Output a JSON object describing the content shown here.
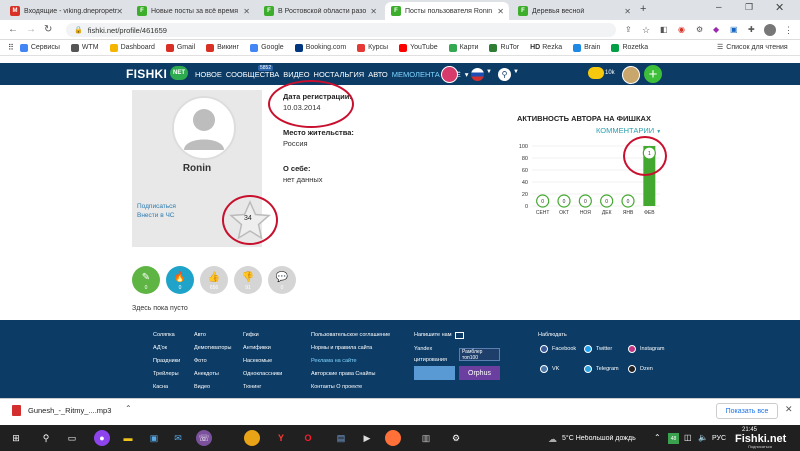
{
  "browser": {
    "tabs": [
      {
        "title": "Входящие - viking.dnepropetr",
        "icon_color": "#d93025",
        "icon_letter": "M"
      },
      {
        "title": "Новые посты за всё время",
        "icon_color": "#3dae2b",
        "icon_letter": "F"
      },
      {
        "title": "В Ростовской области разо",
        "icon_color": "#3dae2b",
        "icon_letter": "F"
      },
      {
        "title": "Посты пользователя Ronin",
        "icon_color": "#3dae2b",
        "icon_letter": "F",
        "active": true
      },
      {
        "title": "Деревья весной",
        "icon_color": "#3dae2b",
        "icon_letter": "F"
      }
    ],
    "new_tab": "+",
    "url": "fishki.net/profile/461659",
    "bookmarks": [
      {
        "label": "Сервисы",
        "color": "#4285f4"
      },
      {
        "label": "WTM",
        "color": "#555555"
      },
      {
        "label": "Dashboard",
        "color": "#f4b400"
      },
      {
        "label": "Gmail",
        "color": "#d93025"
      },
      {
        "label": "Викинг",
        "color": "#d93025"
      },
      {
        "label": "Google",
        "color": "#4285f4"
      },
      {
        "label": "Booking.com",
        "color": "#003580"
      },
      {
        "label": "Курсы",
        "color": "#e53935"
      },
      {
        "label": "YouTube",
        "color": "#ff0000"
      },
      {
        "label": "Карти",
        "color": "#34a853"
      },
      {
        "label": "RuTor",
        "color": "#2e7d32"
      },
      {
        "label": "Rezka",
        "color": "#222222"
      },
      {
        "label": "Brain",
        "color": "#1e88e5"
      },
      {
        "label": "Rozetka",
        "color": "#00a046"
      }
    ],
    "bookmarks_right": "Список для чтения",
    "hd_prefix": "HD"
  },
  "site": {
    "logo": "FISHKI",
    "logo_badge": "NET",
    "nav": [
      "НОВОЕ",
      "СООБЩЕСТВА",
      "ВИДЕО",
      "НОСТАЛЬГИЯ",
      "АВТО",
      "МЕМОЛЕНТА",
      "ЕЩЁ"
    ],
    "nav_badge": "5852",
    "balance": "10k"
  },
  "profile": {
    "username": "Ronin",
    "subscribe_link": "Подписаться",
    "blacklist_link": "Внести в ЧС",
    "rating": "34",
    "reg_label": "Дата регистрации:",
    "reg_value": "10.03.2014",
    "place_label": "Место жительства:",
    "place_value": "Россия",
    "about_label": "О себе:",
    "about_value": "нет данных",
    "actions": [
      {
        "icon": "pencil-icon",
        "glyph": "✎",
        "count": "0",
        "color": "#5fb544"
      },
      {
        "icon": "fire-icon",
        "glyph": "🔥",
        "count": "0",
        "color": "#1fa3c9"
      },
      {
        "icon": "thumbs-up-icon",
        "glyph": "👍",
        "count": "656",
        "color": "#d5d5d5"
      },
      {
        "icon": "thumbs-down-icon",
        "glyph": "👎",
        "count": "91",
        "color": "#d5d5d5"
      },
      {
        "icon": "comment-icon",
        "glyph": "💬",
        "count": "0",
        "color": "#d5d5d5"
      }
    ],
    "empty_text": "Здесь пока пусто"
  },
  "chart_data": {
    "type": "bar",
    "title": "АКТИВНОСТЬ АВТОРА НА ФИШКАХ",
    "subtitle": "КОММЕНТАРИИ",
    "categories": [
      "СЕНТ",
      "ОКТ",
      "НОЯ",
      "ДЕК",
      "ЯНВ",
      "ФЕВ"
    ],
    "values": [
      0,
      0,
      0,
      0,
      0,
      100
    ],
    "point_labels": [
      "0",
      "0",
      "0",
      "0",
      "0",
      "1"
    ],
    "ylim": [
      0,
      100
    ],
    "yticks": [
      0,
      20,
      40,
      60,
      80,
      100
    ],
    "grid": true,
    "bar_color": "#43a82f"
  },
  "footer": {
    "col1": [
      "Соляпка",
      "АД'ок",
      "Праздники",
      "Трейлеры",
      "Касна"
    ],
    "col2": [
      "Авто",
      "Демотиваторы",
      "Фото",
      "Анекдоты",
      "Видео"
    ],
    "col3": [
      "Гифки",
      "Антификки",
      "Насекомые",
      "Одноклассники",
      "Тюнинг"
    ],
    "col4": [
      "Пользовательское соглашение",
      "Нормы и правила сайта",
      "Реклама на сайте",
      "Авторские права  Снайпы",
      "Контакты  О проекте"
    ],
    "write_us": "Напишите нам",
    "yandex": "Yandex",
    "citation": "цитирования",
    "rambler": "Рамблер топ100",
    "orphus": "Orphus",
    "follow": "Наблюдать",
    "social": [
      "Facebook",
      "Twitter",
      "Instagram",
      "VK",
      "Telegram",
      "Dzen"
    ]
  },
  "download": {
    "filename": "Gunesh_-_Ritmy_....mp3",
    "show_all": "Показать все"
  },
  "taskbar": {
    "weather": "5°C  Небольшой дождь",
    "lang": "РУС",
    "time": "21:45",
    "watermark": "Fishki.net",
    "watermark_sub": "Подписаться"
  }
}
